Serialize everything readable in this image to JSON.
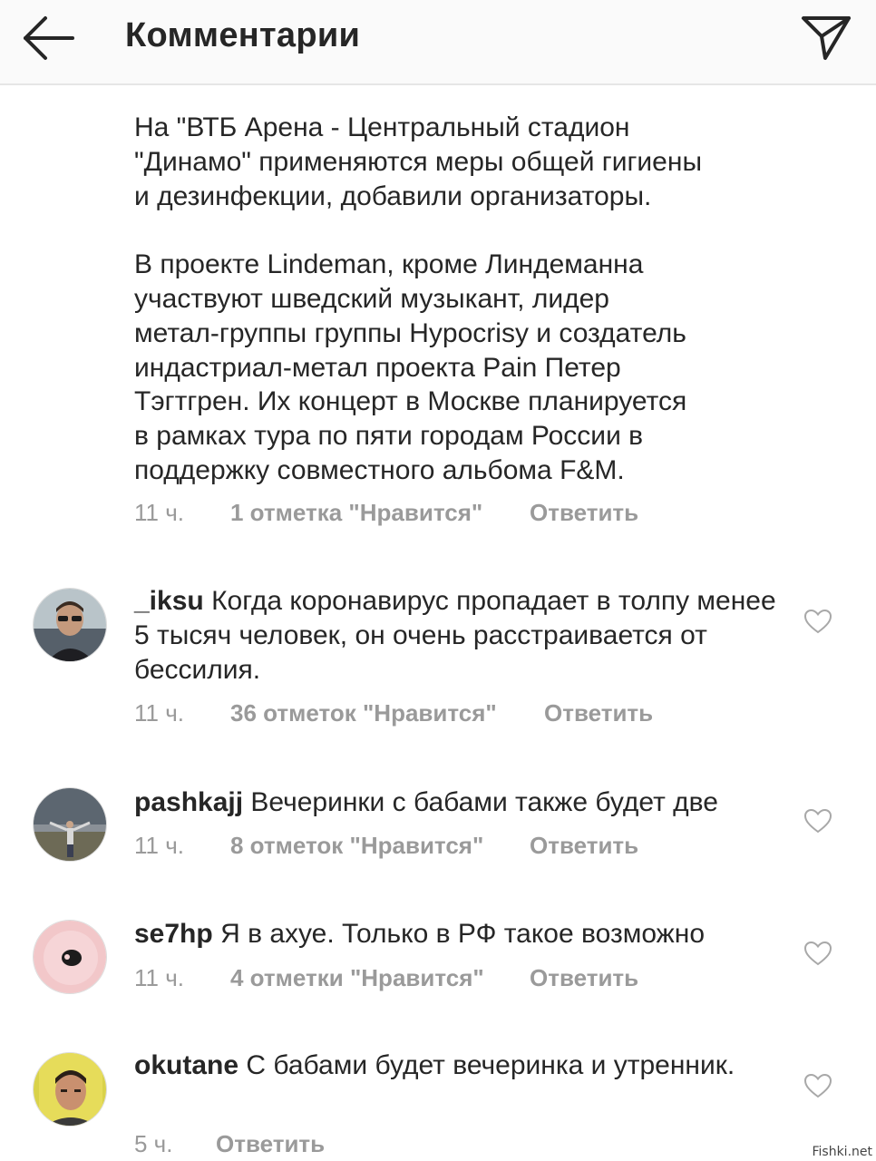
{
  "header": {
    "title": "Комментарии",
    "back_icon": "arrow-left-icon",
    "send_icon": "paper-plane-icon"
  },
  "caption": {
    "text": "На \"ВТБ Арена - Центральный стадион\n\"Динамо\" применяются меры общей гигиены\nи дезинфекции, добавили организаторы.\n\nВ проекте Lindeman, кроме Линдеманна\nучаствуют шведский музыкант, лидер\nметал-группы группы Hypocrisy и создатель\nиндастриал-метал проекта Pain Петер\nТэгтгрен. Их концерт в Москве планируется\nв рамках тура по пяти городам России в\nподдержку совместного альбома F&M.",
    "time": "11 ч.",
    "likes": "1 отметка \"Нравится\"",
    "reply": "Ответить"
  },
  "comments": [
    {
      "username": "_iksu",
      "text": "Когда коронавирус пропадает в толпу менее 5 тысяч человек, он очень расстраивается от бессилия.",
      "time": "11 ч.",
      "likes": "36 отметок \"Нравится\"",
      "reply": "Ответить"
    },
    {
      "username": "pashkajj",
      "text": "Вечеринки с бабами также будет две",
      "time": "11 ч.",
      "likes": "8 отметок \"Нравится\"",
      "reply": "Ответить"
    },
    {
      "username": "se7hp",
      "text": "Я в ахуе. Только в РФ такое возможно",
      "time": "11 ч.",
      "likes": "4 отметки \"Нравится\"",
      "reply": "Ответить"
    },
    {
      "username": "okutane",
      "text": "С бабами будет вечеринка и утренник.",
      "time": "5 ч.",
      "likes": "",
      "reply": "Ответить"
    }
  ],
  "watermark": "Fishki.net",
  "colors": {
    "text": "#262626",
    "meta": "#9a9a9a",
    "header_bg": "#fafafa"
  }
}
